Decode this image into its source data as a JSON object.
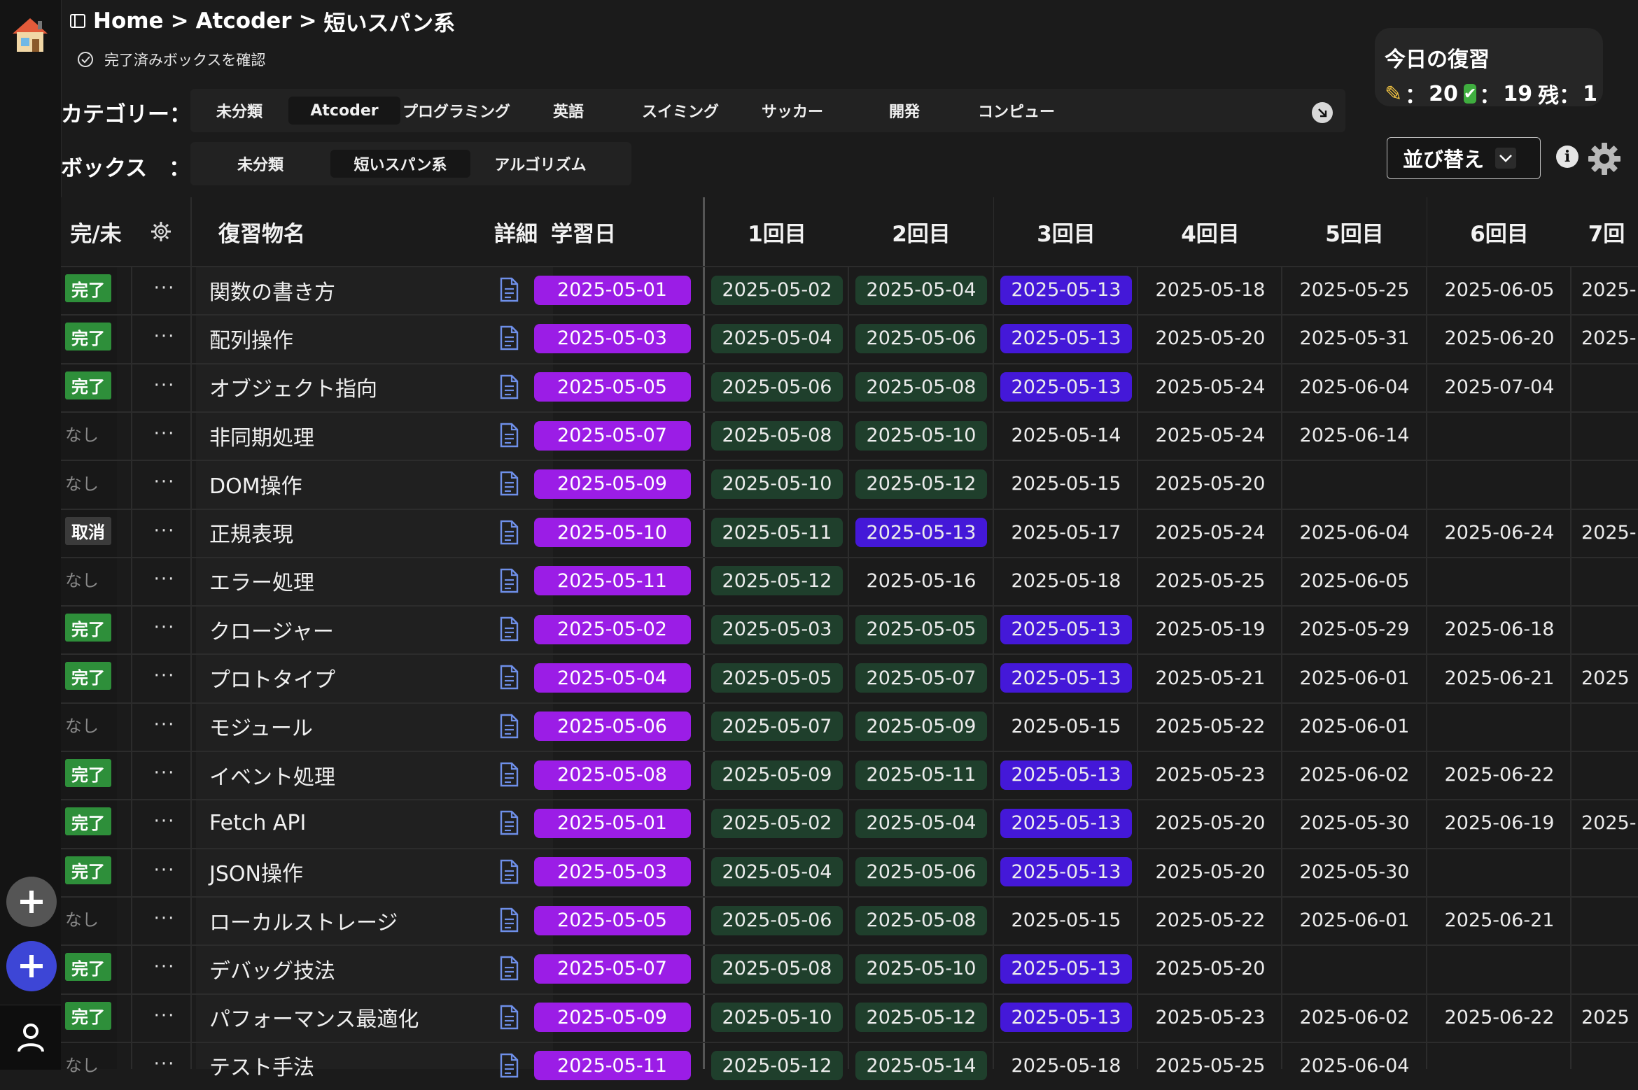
{
  "breadcrumb": {
    "home": "Home",
    "sep1": ">",
    "section": "Atcoder",
    "sep2": ">",
    "page": "短いスパン系"
  },
  "done_check_label": "完了済みボックスを確認",
  "category": {
    "label": "カテゴリー：",
    "items": [
      "未分類",
      "Atcoder",
      "プログラミング",
      "英語",
      "スイミング",
      "サッカー",
      "開発",
      "コンピュー"
    ],
    "active_index": 1
  },
  "box": {
    "label": "ボックス　：",
    "items": [
      "未分類",
      "短いスパン系",
      "アルゴリズム"
    ],
    "active_index": 1
  },
  "today": {
    "title": "今日の復習",
    "pencil_count": "20",
    "check_count": "19",
    "remaining_label": "残：",
    "remaining": "1",
    "colon": "："
  },
  "sort_label": "並び替え",
  "info_glyph": "i",
  "headers": {
    "status": "完/未",
    "name": "復習物名",
    "detail": "詳細",
    "study_date": "学習日",
    "rounds": [
      "1回目",
      "2回目",
      "3回目",
      "4回目",
      "5回目",
      "6回目",
      "7回"
    ]
  },
  "colors": {
    "study_pill": "#9b1de6",
    "done_pill": "#1f3f2c",
    "today_pill": "#4418d8",
    "done_badge": "#2e8f3a"
  },
  "rows": [
    {
      "status": "完了",
      "name": "関数の書き方",
      "study": "2025-05-01",
      "dates": [
        "2025-05-02",
        "2025-05-04",
        "2025-05-13",
        "2025-05-18",
        "2025-05-25",
        "2025-06-05",
        "2025-"
      ],
      "states": [
        "done",
        "done",
        "today",
        "",
        "",
        "",
        ""
      ]
    },
    {
      "status": "完了",
      "name": "配列操作",
      "study": "2025-05-03",
      "dates": [
        "2025-05-04",
        "2025-05-06",
        "2025-05-13",
        "2025-05-20",
        "2025-05-31",
        "2025-06-20",
        "2025-"
      ],
      "states": [
        "done",
        "done",
        "today",
        "",
        "",
        "",
        ""
      ]
    },
    {
      "status": "完了",
      "name": "オブジェクト指向",
      "study": "2025-05-05",
      "dates": [
        "2025-05-06",
        "2025-05-08",
        "2025-05-13",
        "2025-05-24",
        "2025-06-04",
        "2025-07-04",
        ""
      ],
      "states": [
        "done",
        "done",
        "today",
        "",
        "",
        "",
        ""
      ]
    },
    {
      "status": "なし",
      "name": "非同期処理",
      "study": "2025-05-07",
      "dates": [
        "2025-05-08",
        "2025-05-10",
        "2025-05-14",
        "2025-05-24",
        "2025-06-14",
        "",
        ""
      ],
      "states": [
        "done",
        "done",
        "",
        "",
        "",
        "",
        ""
      ]
    },
    {
      "status": "なし",
      "name": "DOM操作",
      "study": "2025-05-09",
      "dates": [
        "2025-05-10",
        "2025-05-12",
        "2025-05-15",
        "2025-05-20",
        "",
        "",
        ""
      ],
      "states": [
        "done",
        "done",
        "",
        "",
        "",
        "",
        ""
      ]
    },
    {
      "status": "取消",
      "name": "正規表現",
      "study": "2025-05-10",
      "dates": [
        "2025-05-11",
        "2025-05-13",
        "2025-05-17",
        "2025-05-24",
        "2025-06-04",
        "2025-06-24",
        "2025-"
      ],
      "states": [
        "done",
        "today",
        "",
        "",
        "",
        "",
        ""
      ]
    },
    {
      "status": "なし",
      "name": "エラー処理",
      "study": "2025-05-11",
      "dates": [
        "2025-05-12",
        "2025-05-16",
        "2025-05-18",
        "2025-05-25",
        "2025-06-05",
        "",
        ""
      ],
      "states": [
        "done",
        "",
        "",
        "",
        "",
        "",
        ""
      ]
    },
    {
      "status": "完了",
      "name": "クロージャー",
      "study": "2025-05-02",
      "dates": [
        "2025-05-03",
        "2025-05-05",
        "2025-05-13",
        "2025-05-19",
        "2025-05-29",
        "2025-06-18",
        ""
      ],
      "states": [
        "done",
        "done",
        "today",
        "",
        "",
        "",
        ""
      ]
    },
    {
      "status": "完了",
      "name": "プロトタイプ",
      "study": "2025-05-04",
      "dates": [
        "2025-05-05",
        "2025-05-07",
        "2025-05-13",
        "2025-05-21",
        "2025-06-01",
        "2025-06-21",
        "2025"
      ],
      "states": [
        "done",
        "done",
        "today",
        "",
        "",
        "",
        ""
      ]
    },
    {
      "status": "なし",
      "name": "モジュール",
      "study": "2025-05-06",
      "dates": [
        "2025-05-07",
        "2025-05-09",
        "2025-05-15",
        "2025-05-22",
        "2025-06-01",
        "",
        ""
      ],
      "states": [
        "done",
        "done",
        "",
        "",
        "",
        "",
        ""
      ]
    },
    {
      "status": "完了",
      "name": "イベント処理",
      "study": "2025-05-08",
      "dates": [
        "2025-05-09",
        "2025-05-11",
        "2025-05-13",
        "2025-05-23",
        "2025-06-02",
        "2025-06-22",
        ""
      ],
      "states": [
        "done",
        "done",
        "today",
        "",
        "",
        "",
        ""
      ]
    },
    {
      "status": "完了",
      "name": "Fetch API",
      "study": "2025-05-01",
      "dates": [
        "2025-05-02",
        "2025-05-04",
        "2025-05-13",
        "2025-05-20",
        "2025-05-30",
        "2025-06-19",
        "2025-"
      ],
      "states": [
        "done",
        "done",
        "today",
        "",
        "",
        "",
        ""
      ]
    },
    {
      "status": "完了",
      "name": "JSON操作",
      "study": "2025-05-03",
      "dates": [
        "2025-05-04",
        "2025-05-06",
        "2025-05-13",
        "2025-05-20",
        "2025-05-30",
        "",
        ""
      ],
      "states": [
        "done",
        "done",
        "today",
        "",
        "",
        "",
        ""
      ]
    },
    {
      "status": "なし",
      "name": "ローカルストレージ",
      "study": "2025-05-05",
      "dates": [
        "2025-05-06",
        "2025-05-08",
        "2025-05-15",
        "2025-05-22",
        "2025-06-01",
        "2025-06-21",
        ""
      ],
      "states": [
        "done",
        "done",
        "",
        "",
        "",
        "",
        ""
      ]
    },
    {
      "status": "完了",
      "name": "デバッグ技法",
      "study": "2025-05-07",
      "dates": [
        "2025-05-08",
        "2025-05-10",
        "2025-05-13",
        "2025-05-20",
        "",
        "",
        ""
      ],
      "states": [
        "done",
        "done",
        "today",
        "",
        "",
        "",
        ""
      ]
    },
    {
      "status": "完了",
      "name": "パフォーマンス最適化",
      "study": "2025-05-09",
      "dates": [
        "2025-05-10",
        "2025-05-12",
        "2025-05-13",
        "2025-05-23",
        "2025-06-02",
        "2025-06-22",
        "2025"
      ],
      "states": [
        "done",
        "done",
        "today",
        "",
        "",
        "",
        ""
      ]
    },
    {
      "status": "なし",
      "name": "テスト手法",
      "study": "2025-05-11",
      "dates": [
        "2025-05-12",
        "2025-05-14",
        "2025-05-18",
        "2025-05-25",
        "2025-06-04",
        "",
        ""
      ],
      "states": [
        "done",
        "done",
        "",
        "",
        "",
        "",
        ""
      ]
    }
  ]
}
